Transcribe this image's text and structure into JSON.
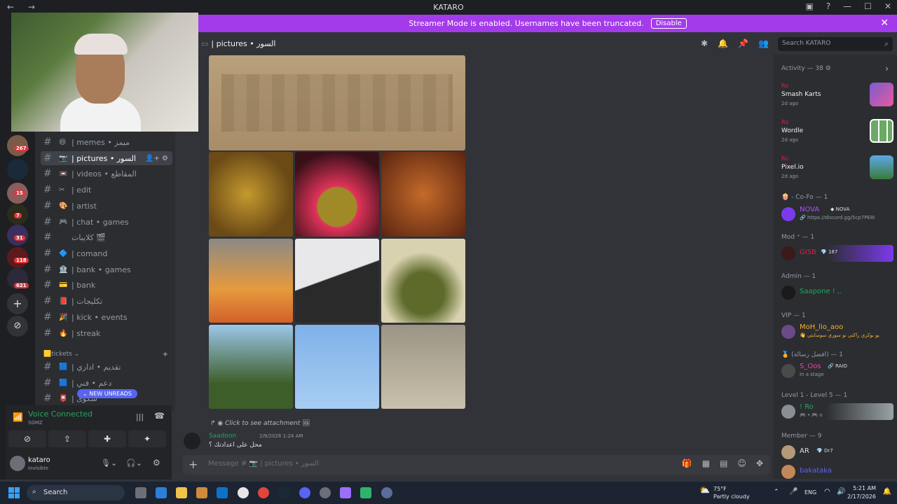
{
  "window": {
    "title": "KATARO",
    "nav": "← →"
  },
  "banner": {
    "text": "Streamer Mode is enabled. Usernames have been truncated.",
    "button": "Disable",
    "color": "#a43bea"
  },
  "servers": {
    "badges": [
      "267",
      "15",
      "7",
      "31",
      "118",
      "621"
    ]
  },
  "channels": [
    {
      "emoji": "😄",
      "label": "| memes • ميمز"
    },
    {
      "emoji": "📷",
      "label": "| pictures • السور"
    },
    {
      "emoji": "📼",
      "label": "| videos • المقاطع"
    },
    {
      "emoji": "✂",
      "label": "| edit"
    },
    {
      "emoji": "🎨",
      "label": "| artist"
    },
    {
      "emoji": "🎮",
      "label": "| chat • games"
    },
    {
      "emoji": "",
      "label": "كلايبات 🎬"
    },
    {
      "emoji": "🔷",
      "label": "| comand"
    },
    {
      "emoji": "🏦",
      "label": "| bank • games"
    },
    {
      "emoji": "💳",
      "label": "| bank"
    },
    {
      "emoji": "📕",
      "label": "| تكليجات"
    },
    {
      "emoji": "🎉",
      "label": "| kick • events"
    },
    {
      "emoji": "🔥",
      "label": "| streak"
    }
  ],
  "category": {
    "label": "🟨tickets ⌄"
  },
  "ticket_channels": [
    {
      "emoji": "🟦",
      "label": "| تقديم • اداري"
    },
    {
      "emoji": "🟦",
      "label": "| دعم • فني"
    },
    {
      "emoji": "📮",
      "label": "| شكوى"
    }
  ],
  "new_unreads": "⌄ NEW UNREADS",
  "voice": {
    "title": "Voice Connected",
    "sub": "SGMZ"
  },
  "user": {
    "name": "kataro",
    "status": "Invisible"
  },
  "chat": {
    "channel": "| pictures • السور",
    "attachment_link": "Click to see attachment",
    "author": "Saadoon",
    "timestamp": "2/9/2026 1:24 AM",
    "message": "محل على اعدادتك ؟",
    "composer_placeholder": "Message # 📷 | pictures • السور"
  },
  "search": {
    "placeholder": "Search KATARO"
  },
  "members": {
    "activity_header": "Activity — 38 ⚙",
    "activities": [
      {
        "user": "Ro",
        "game": "Smash Karts",
        "ago": "2d ago"
      },
      {
        "user": "Ro",
        "game": "Wordle",
        "ago": "2d ago"
      },
      {
        "user": "Ro",
        "game": "Pixel.io",
        "ago": "2d ago"
      }
    ],
    "groups": [
      {
        "header": "🍿 - Co-Fo — 1",
        "name": "NOVA",
        "tag": "◆ NOVA",
        "sub": "🔗 https://discord.gg/5cp7PE8I",
        "color": "#a855f7"
      },
      {
        "header": "Mod ⁺ — 1",
        "name": "GISB",
        "tag": "💎 187",
        "sub": "",
        "color": "#e11d48"
      },
      {
        "header": "Admin — 1",
        "name": "Saapone ! ,.",
        "tag": "",
        "sub": "",
        "color": "#23a55a"
      },
      {
        "header": "VIP — 1",
        "name": "MoH_lio_aoo",
        "tag": "",
        "sub": "👋 يو بوكري راكتي نو سوري سوسايتي",
        "color": "#f0b232"
      },
      {
        "header": "🏅 (افضل رسالة) — 1",
        "name": "S_Oos",
        "tag": "🔗 RAIO",
        "sub": "In a stage",
        "color": "#eb459e"
      },
      {
        "header": "Level 1 - Level 5 — 1",
        "name": "! Ro",
        "tag": "",
        "sub": "🎮 • 🎮 o",
        "color": "#23a55a"
      },
      {
        "header": "Member — 9",
        "name": "AR",
        "tag": "💎 Dr7",
        "sub": "",
        "color": "#dbdee1"
      },
      {
        "header": "",
        "name": "bakataka",
        "tag": "",
        "sub": "",
        "color": "#5865f2"
      }
    ]
  },
  "taskbar": {
    "search": "Search",
    "weather_temp": "75°F",
    "weather_desc": "Partly cloudy",
    "lang": "ENG",
    "time": "5:21 AM",
    "date": "2/17/2026"
  }
}
